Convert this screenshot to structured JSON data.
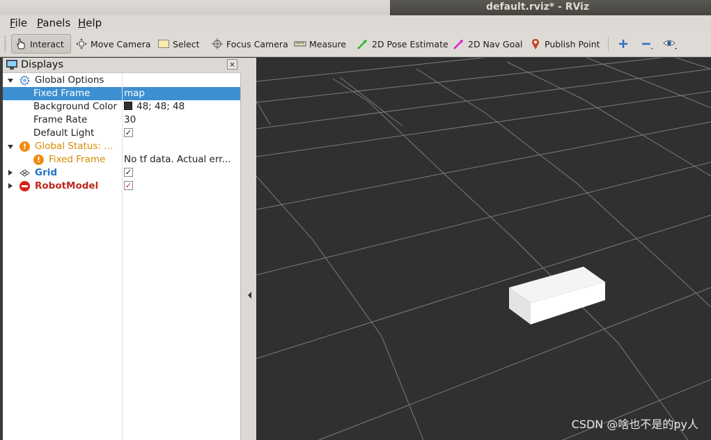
{
  "window": {
    "title": "default.rviz* - RViz"
  },
  "menu": [
    {
      "label_u": "F",
      "label_rest": "ile"
    },
    {
      "label_u": "P",
      "label_rest": "anels"
    },
    {
      "label_u": "H",
      "label_rest": "elp"
    }
  ],
  "toolbar": {
    "interact": "Interact",
    "move_camera": "Move Camera",
    "select": "Select",
    "focus_camera": "Focus Camera",
    "measure": "Measure",
    "pose_estimate": "2D Pose Estimate",
    "nav_goal": "2D Nav Goal",
    "publish_point": "Publish Point"
  },
  "displays": {
    "title": "Displays",
    "close": "×",
    "rows": {
      "global_options": "Global Options",
      "fixed_frame": {
        "key": "Fixed Frame",
        "value": "map"
      },
      "background_color": {
        "key": "Background Color",
        "value": "48; 48; 48"
      },
      "frame_rate": {
        "key": "Frame Rate",
        "value": "30"
      },
      "default_light": {
        "key": "Default Light",
        "checked": true
      },
      "global_status": "Global Status: ...",
      "status_fixed_frame": {
        "key": "Fixed Frame",
        "value": "No tf data.  Actual err..."
      },
      "grid": {
        "key": "Grid",
        "checked": true
      },
      "robot_model": {
        "key": "RobotModel",
        "checked": true
      }
    }
  },
  "view": {
    "background": "#303030"
  },
  "watermark": "CSDN @啥也不是的py人",
  "colors": {
    "selection": "#3d8fd1",
    "warning": "#d48a00",
    "error": "#c0281e",
    "grid_link": "#1f6fc4"
  }
}
